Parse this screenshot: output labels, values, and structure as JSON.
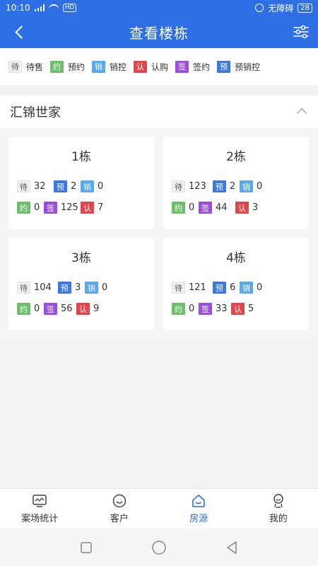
{
  "status": {
    "time": "10:10",
    "network": "HD",
    "no_disturb": "无障碍",
    "battery": "28"
  },
  "header": {
    "title": "查看楼栋"
  },
  "legend": [
    {
      "badge": "待",
      "label": "待售",
      "color": "#f0f0f0"
    },
    {
      "badge": "约",
      "label": "预约",
      "color": "#6cc06a"
    },
    {
      "badge": "销",
      "label": "销控",
      "color": "#57a8ef"
    },
    {
      "badge": "认",
      "label": "认购",
      "color": "#e0474c"
    },
    {
      "badge": "签",
      "label": "签约",
      "color": "#9a4ce3"
    },
    {
      "badge": "预",
      "label": "预销控",
      "color": "#3a78e7"
    }
  ],
  "project": {
    "name": "汇锦世家"
  },
  "buildings": [
    {
      "name": "1栋",
      "dai": "32",
      "yu": "2",
      "xiao": "0",
      "yue": "0",
      "qian": "125",
      "ren": "7"
    },
    {
      "name": "2栋",
      "dai": "123",
      "yu": "2",
      "xiao": "0",
      "yue": "0",
      "qian": "44",
      "ren": "3"
    },
    {
      "name": "3栋",
      "dai": "104",
      "yu": "3",
      "xiao": "0",
      "yue": "0",
      "qian": "56",
      "ren": "9"
    },
    {
      "name": "4栋",
      "dai": "121",
      "yu": "6",
      "xiao": "0",
      "yue": "0",
      "qian": "33",
      "ren": "5"
    }
  ],
  "badges": {
    "dai": "待",
    "yu": "预",
    "xiao": "销",
    "yue": "约",
    "qian": "签",
    "ren": "认"
  },
  "tabs": [
    {
      "label": "案场统计",
      "icon": "monitor-icon",
      "active": false
    },
    {
      "label": "客户",
      "icon": "smile-icon",
      "active": false
    },
    {
      "label": "房源",
      "icon": "house-icon",
      "active": true
    },
    {
      "label": "我的",
      "icon": "user-icon",
      "active": false
    }
  ],
  "accent": "#2e6fe6"
}
